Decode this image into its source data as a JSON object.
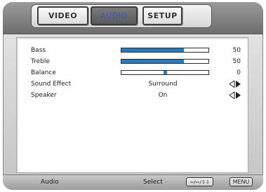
{
  "tabs": [
    {
      "label": "VIDEO",
      "active": false
    },
    {
      "label": "AUDIO",
      "active": true
    },
    {
      "label": "SETUP",
      "active": false
    }
  ],
  "settings": {
    "bass": {
      "label": "Bass",
      "value": "50",
      "level": 0.72
    },
    "treble": {
      "label": "Treble",
      "value": "50",
      "level": 0.72
    },
    "balance": {
      "label": "Balance",
      "value": "0",
      "position": 0.5
    },
    "sound_effect": {
      "label": "Sound Effect",
      "value": "Surround"
    },
    "speaker": {
      "label": "Speaker",
      "value": "On"
    }
  },
  "footer": {
    "page_name": "Audio",
    "select_hint": "Select",
    "nav_key": "⇦/⇨/⇧⇩",
    "menu_key": "MENU"
  },
  "colors": {
    "slider_fill": "#1a7fd0",
    "active_tab_text": "#3b4fd4"
  },
  "icons": {
    "left_right_arrows": "left-right-arrows-icon"
  }
}
